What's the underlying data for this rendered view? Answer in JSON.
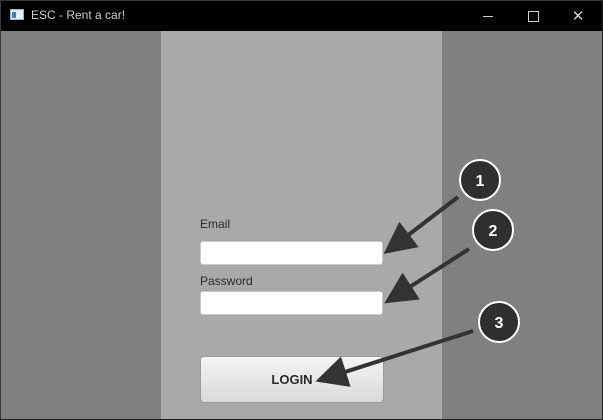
{
  "window": {
    "title": "ESC - Rent a car!",
    "icons": {
      "app": "app-window-icon",
      "minimize": "minimize-icon",
      "maximize": "maximize-icon",
      "close": "close-icon"
    },
    "close_glyph": "✕"
  },
  "login_form": {
    "email_label": "Email",
    "email_value": "",
    "password_label": "Password",
    "password_value": "",
    "login_label": "LOGIN"
  },
  "annotations": {
    "badges": [
      "1",
      "2",
      "3"
    ],
    "badge_color": "#2f2f2f",
    "arrow_color": "#333333"
  },
  "colors": {
    "background": "#808080",
    "center_panel": "#a9a9a9",
    "titlebar": "#000000"
  }
}
